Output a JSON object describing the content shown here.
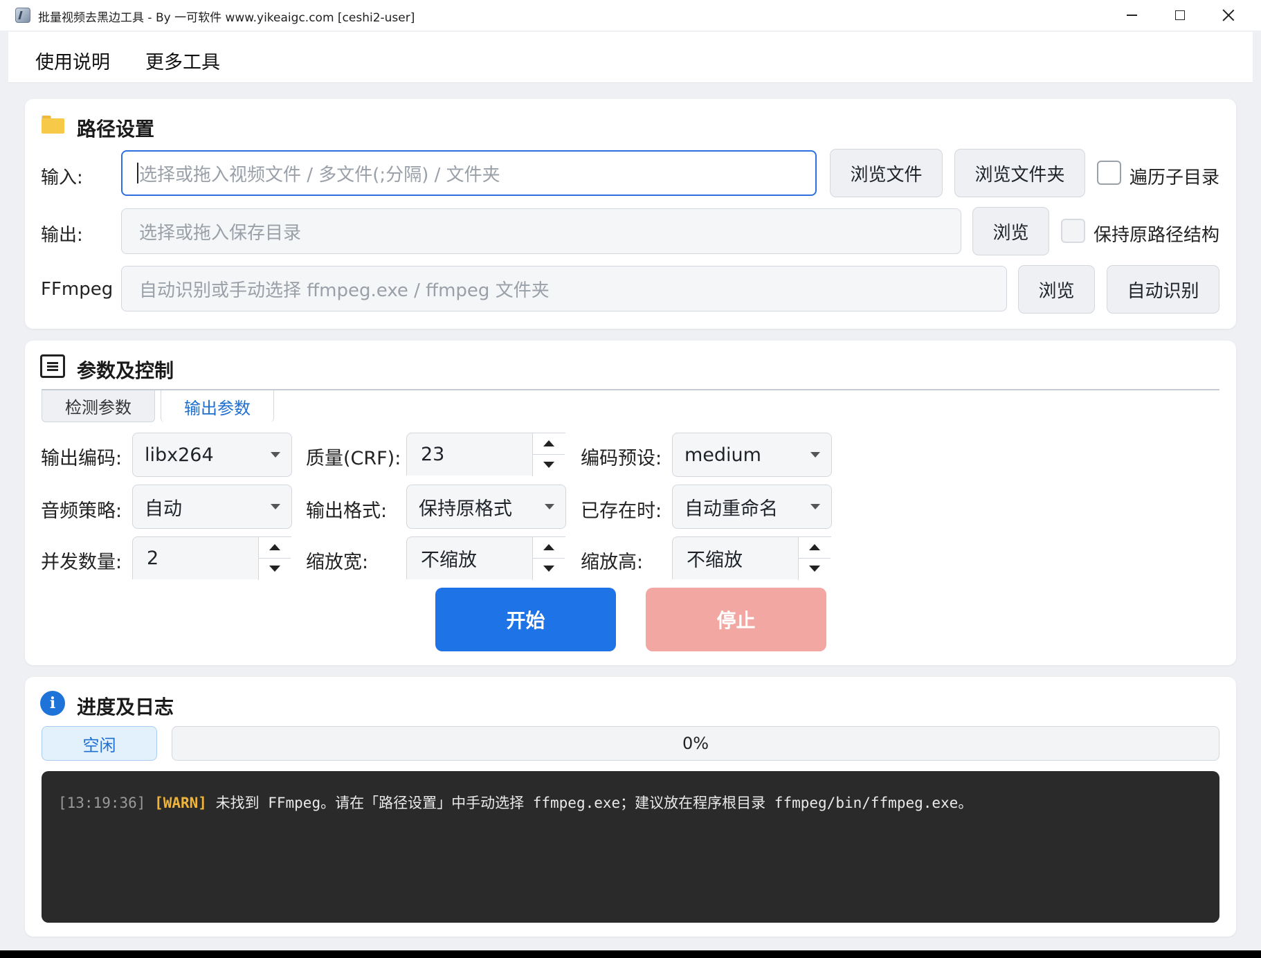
{
  "window": {
    "title": "批量视频去黑边工具 - By 一可软件 www.yikeaigc.com  [ceshi2-user]"
  },
  "menu": {
    "help": "使用说明",
    "tools": "更多工具"
  },
  "path_settings": {
    "title": "路径设置",
    "input_label": "输入:",
    "input_placeholder": "选择或拖入视频文件 / 多文件(;分隔) / 文件夹",
    "browse_file": "浏览文件",
    "browse_folder": "浏览文件夹",
    "recursive_label": "遍历子目录",
    "recursive_checked": false,
    "output_label": "输出:",
    "output_placeholder": "选择或拖入保存目录",
    "output_browse": "浏览",
    "keep_structure_label": "保持原路径结构",
    "keep_structure_checked": false,
    "ffmpeg_label": "FFmpeg",
    "ffmpeg_placeholder": "自动识别或手动选择 ffmpeg.exe / ffmpeg 文件夹",
    "ffmpeg_browse": "浏览",
    "ffmpeg_auto": "自动识别"
  },
  "params": {
    "title": "参数及控制",
    "tabs": [
      {
        "label": "检测参数",
        "active": false
      },
      {
        "label": "输出参数",
        "active": true
      }
    ],
    "codec_label": "输出编码:",
    "codec_value": "libx264",
    "crf_label": "质量(CRF):",
    "crf_value": "23",
    "preset_label": "编码预设:",
    "preset_value": "medium",
    "audio_label": "音频策略:",
    "audio_value": "自动",
    "format_label": "输出格式:",
    "format_value": "保持原格式",
    "exists_label": "已存在时:",
    "exists_value": "自动重命名",
    "concurrency_label": "并发数量:",
    "concurrency_value": "2",
    "scale_w_label": "缩放宽:",
    "scale_w_value": "不缩放",
    "scale_h_label": "缩放高:",
    "scale_h_value": "不缩放",
    "start": "开始",
    "stop": "停止"
  },
  "progress": {
    "title": "进度及日志",
    "status": "空闲",
    "percent_text": "0%",
    "percent": 0,
    "log": [
      {
        "time": "[13:19:36]",
        "level": "[WARN]",
        "message": " 未找到 FFmpeg。请在「路径设置」中手动选择 ffmpeg.exe；建议放在程序根目录 ffmpeg/bin/ffmpeg.exe。"
      }
    ]
  },
  "colors": {
    "accent": "#1e73e6",
    "stop": "#f2a7a2",
    "warn": "#f0b43a",
    "log_bg": "#2a2a2a"
  },
  "icons": {
    "path_settings": "folder-icon",
    "params": "document-list-icon",
    "progress": "info-icon"
  }
}
